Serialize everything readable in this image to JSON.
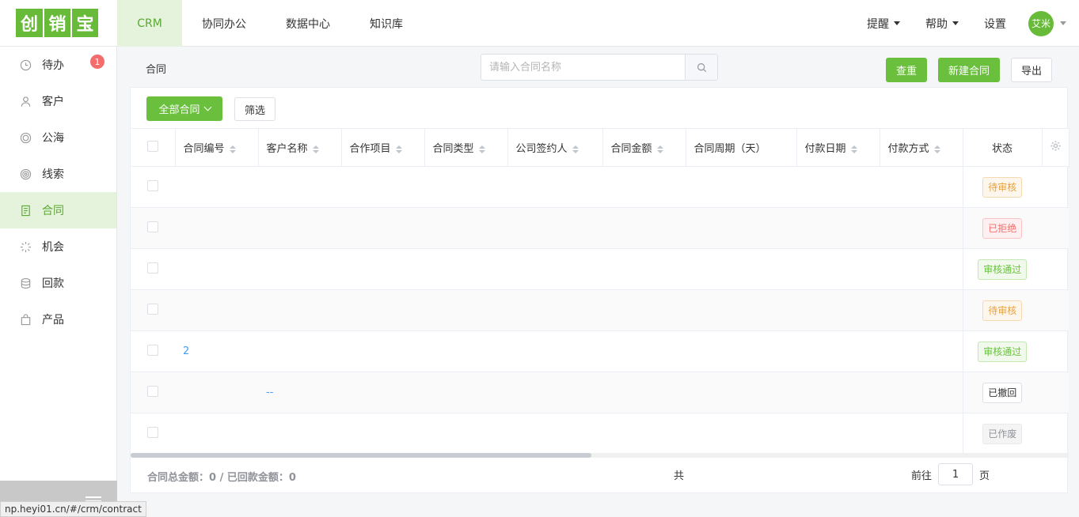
{
  "logo": {
    "chars": [
      "创",
      "销",
      "宝"
    ]
  },
  "topnav": [
    {
      "label": "CRM",
      "active": true
    },
    {
      "label": "协同办公"
    },
    {
      "label": "数据中心"
    },
    {
      "label": "知识库"
    }
  ],
  "topright": {
    "remind": "提醒",
    "help": "帮助",
    "settings": "设置",
    "avatar_text": "艾米"
  },
  "sidebar": {
    "items": [
      {
        "label": "待办",
        "icon": "clock-icon",
        "badge": "1"
      },
      {
        "label": "客户",
        "icon": "user-icon"
      },
      {
        "label": "公海",
        "icon": "ring-icon"
      },
      {
        "label": "线索",
        "icon": "target-icon"
      },
      {
        "label": "合同",
        "icon": "document-icon",
        "active": true
      },
      {
        "label": "机会",
        "icon": "spark-icon"
      },
      {
        "label": "回款",
        "icon": "coins-icon"
      },
      {
        "label": "产品",
        "icon": "bag-icon"
      }
    ]
  },
  "status_url": "np.heyi01.cn/#/crm/contract",
  "main": {
    "breadcrumb": "合同",
    "search_placeholder": "请输入合同名称",
    "buttons": {
      "query": "查重",
      "create": "新建合同",
      "export": "导出"
    },
    "all_contracts": "全部合同",
    "filter": "筛选"
  },
  "table": {
    "columns": [
      "合同编号",
      "客户名称",
      "合作项目",
      "合同类型",
      "公司签约人",
      "合同金额",
      "合同周期（天）",
      "付款日期",
      "付款方式",
      "状态"
    ],
    "rows": [
      {
        "number": "",
        "customer": "",
        "status": "待审核",
        "kind": "wait"
      },
      {
        "number": "",
        "customer": "",
        "status": "已拒绝",
        "kind": "reject"
      },
      {
        "number": "",
        "customer": "",
        "status": "审核通过",
        "kind": "pass"
      },
      {
        "number": "",
        "customer": "",
        "status": "待审核",
        "kind": "wait"
      },
      {
        "number": "2",
        "customer": "",
        "status": "审核通过",
        "kind": "pass"
      },
      {
        "number": "",
        "customer": "--",
        "status": "已撤回",
        "kind": "recall"
      },
      {
        "number": "",
        "customer": "",
        "status": "已作废",
        "kind": "void"
      }
    ]
  },
  "footer": {
    "summary": "合同总金额：0 / 已回款金额：0",
    "total": "共",
    "goto": "前往",
    "page": "1",
    "page_unit": "页"
  },
  "colors": {
    "brand": "#6abf3c",
    "active_bg": "#e6f3dc",
    "badge": "#f56c6c"
  }
}
